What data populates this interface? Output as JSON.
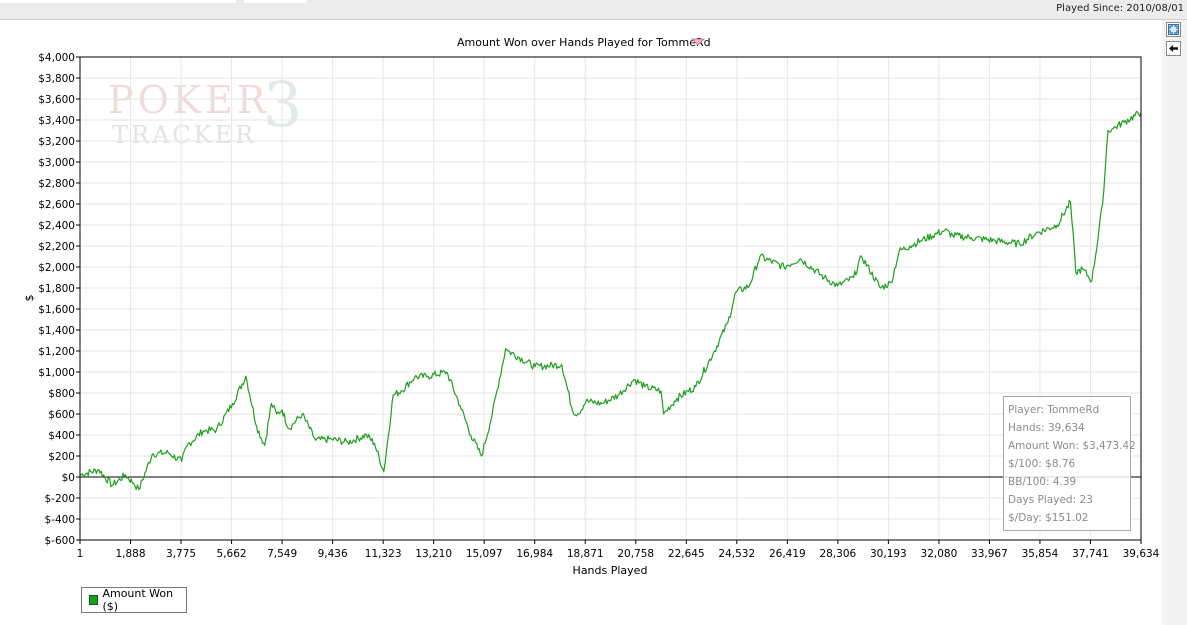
{
  "header": {
    "played_since": "Played Since: 2010/08/01"
  },
  "side_buttons": [
    {
      "icon": "expand-icon"
    },
    {
      "icon": "back-arrow-icon"
    }
  ],
  "watermark": {
    "line1": "POKER",
    "line2": "TRACKER",
    "mark": "3"
  },
  "stats": {
    "player": "Player: TommeRd",
    "hands": "Hands: 39,634",
    "amount_won": "Amount Won: $3,473.42",
    "per100": "$/100: $8.76",
    "bb100": "BB/100: 4.39",
    "days_played": "Days Played: 23",
    "per_day": "$/Day: $151.02"
  },
  "legend": {
    "label": "Amount Won ($)"
  },
  "colors": {
    "series": "#1f9e1f",
    "grid": "#e6e6e6",
    "zero_line": "#000000"
  },
  "chart_data": {
    "type": "line",
    "title": "Amount Won over Hands Played for TommeRd",
    "xlabel": "Hands Played",
    "ylabel": "$",
    "xlim": [
      1,
      39634
    ],
    "ylim": [
      -600,
      4000
    ],
    "x_ticks": [
      "1",
      "1,888",
      "3,775",
      "5,662",
      "7,549",
      "9,436",
      "11,323",
      "13,210",
      "15,097",
      "16,984",
      "18,871",
      "20,758",
      "22,645",
      "24,532",
      "26,419",
      "28,306",
      "30,193",
      "32,080",
      "33,967",
      "35,854",
      "37,741",
      "39,634"
    ],
    "y_ticks": [
      "$4,000",
      "$3,800",
      "$3,600",
      "$3,400",
      "$3,200",
      "$3,000",
      "$2,800",
      "$2,600",
      "$2,400",
      "$2,200",
      "$2,000",
      "$1,800",
      "$1,600",
      "$1,400",
      "$1,200",
      "$1,000",
      "$800",
      "$600",
      "$400",
      "$200",
      "$0",
      "$-200",
      "$-400",
      "$-600"
    ],
    "grid": true,
    "legend_position": "bottom-left",
    "series": [
      {
        "name": "Amount Won ($)",
        "x": [
          1,
          700,
          1200,
          1700,
          2000,
          2200,
          2700,
          3300,
          3800,
          4000,
          4600,
          5100,
          5700,
          6200,
          6600,
          6900,
          7150,
          7350,
          7550,
          7800,
          8300,
          8800,
          9400,
          10000,
          10700,
          11000,
          11350,
          11700,
          12000,
          12500,
          13000,
          13700,
          14200,
          14600,
          15000,
          15400,
          15900,
          16000,
          17000,
          18000,
          18400,
          18600,
          18900,
          19500,
          20100,
          20700,
          21100,
          21700,
          21800,
          22300,
          23000,
          23700,
          24200,
          24500,
          25000,
          25400,
          26300,
          26900,
          27800,
          28300,
          28900,
          29200,
          29900,
          30300,
          30600,
          31000,
          31400,
          32300,
          32600,
          33300,
          34200,
          35100,
          35700,
          36500,
          37000,
          37200,
          37450,
          37800,
          38200,
          38400,
          38600,
          39000,
          39634
        ],
        "y": [
          20,
          70,
          -80,
          20,
          -60,
          -120,
          220,
          230,
          150,
          300,
          440,
          450,
          700,
          960,
          480,
          300,
          700,
          600,
          640,
          460,
          600,
          350,
          360,
          330,
          400,
          320,
          50,
          780,
          820,
          950,
          960,
          1000,
          680,
          400,
          200,
          600,
          1220,
          1200,
          1050,
          1070,
          630,
          600,
          720,
          700,
          780,
          930,
          860,
          820,
          600,
          750,
          860,
          1200,
          1470,
          1760,
          1820,
          2100,
          2000,
          2080,
          1900,
          1820,
          1900,
          2100,
          1800,
          1850,
          2150,
          2200,
          2250,
          2350,
          2300,
          2280,
          2250,
          2220,
          2320,
          2400,
          2620,
          1950,
          1980,
          1870,
          2600,
          3300,
          3320,
          3380,
          3473
        ]
      }
    ]
  }
}
